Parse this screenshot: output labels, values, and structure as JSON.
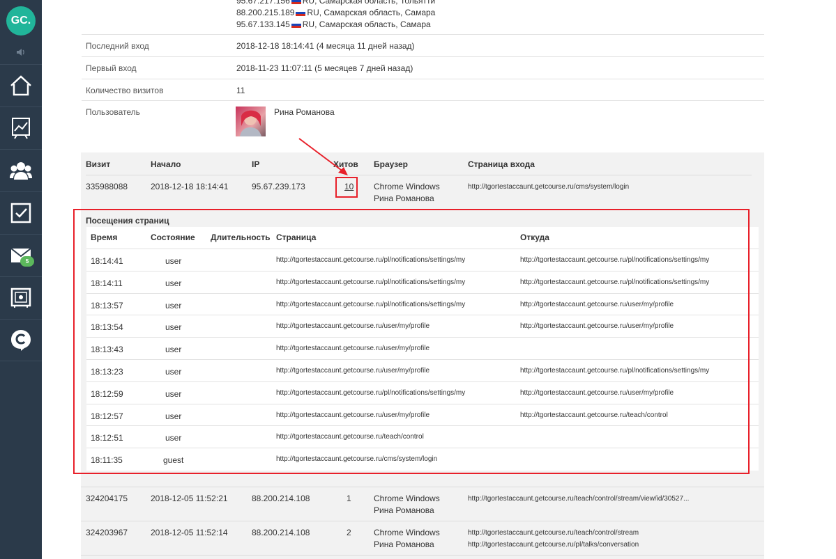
{
  "sidebar": {
    "logo": "GC.",
    "mail_badge": "5",
    "items": [
      "home-icon",
      "chart-icon",
      "users-icon",
      "tasks-icon",
      "mail-icon",
      "safe-icon",
      "chat-icon"
    ]
  },
  "ip_list": [
    {
      "ip": "95.67.217.156",
      "flag": "RU",
      "loc": "RU, Самарская область, Тольятти"
    },
    {
      "ip": "88.200.215.189",
      "flag": "RU",
      "loc": "RU, Самарская область, Самара"
    },
    {
      "ip": "95.67.133.145",
      "flag": "RU",
      "loc": "RU, Самарская область, Самара"
    }
  ],
  "info": {
    "last_login_label": "Последний вход",
    "last_login_value": "2018-12-18 18:14:41 (4 месяца 11 дней назад)",
    "first_login_label": "Первый вход",
    "first_login_value": "2018-11-23 11:07:11 (5 месяцев 7 дней назад)",
    "visits_count_label": "Количество визитов",
    "visits_count_value": "11",
    "user_label": "Пользователь",
    "user_name": "Рина Романова"
  },
  "visits_table": {
    "headers": {
      "visit": "Визит",
      "start": "Начало",
      "ip": "IP",
      "hits": "Хитов",
      "browser": "Браузер",
      "entry": "Страница входа"
    },
    "rows": [
      {
        "visit": "335988088",
        "start": "2018-12-18 18:14:41",
        "ip": "95.67.239.173",
        "hits": "10",
        "browser": "Chrome Windows",
        "user": "Рина Романова",
        "entry": "http://tgortestaccaunt.getcourse.ru/cms/system/login",
        "entry2": ""
      },
      {
        "visit": "324204175",
        "start": "2018-12-05 11:52:21",
        "ip": "88.200.214.108",
        "hits": "1",
        "browser": "Chrome Windows",
        "user": "Рина Романова",
        "entry": "http://tgortestaccaunt.getcourse.ru/teach/control/stream/view/id/30527...",
        "entry2": ""
      },
      {
        "visit": "324203967",
        "start": "2018-12-05 11:52:14",
        "ip": "88.200.214.108",
        "hits": "2",
        "browser": "Chrome Windows",
        "user": "Рина Романова",
        "entry": "http://tgortestaccaunt.getcourse.ru/teach/control/stream",
        "entry2": "http://tgortestaccaunt.getcourse.ru/pl/talks/conversation"
      }
    ]
  },
  "page_views": {
    "title": "Посещения страниц",
    "headers": {
      "time": "Время",
      "state": "Состояние",
      "duration": "Длительность",
      "page": "Страница",
      "from": "Откуда"
    },
    "rows": [
      {
        "time": "18:14:41",
        "state": "user",
        "page": "http://tgortestaccaunt.getcourse.ru/pl/notifications/settings/my",
        "from": "http://tgortestaccaunt.getcourse.ru/pl/notifications/settings/my"
      },
      {
        "time": "18:14:11",
        "state": "user",
        "page": "http://tgortestaccaunt.getcourse.ru/pl/notifications/settings/my",
        "from": "http://tgortestaccaunt.getcourse.ru/pl/notifications/settings/my"
      },
      {
        "time": "18:13:57",
        "state": "user",
        "page": "http://tgortestaccaunt.getcourse.ru/pl/notifications/settings/my",
        "from": "http://tgortestaccaunt.getcourse.ru/user/my/profile"
      },
      {
        "time": "18:13:54",
        "state": "user",
        "page": "http://tgortestaccaunt.getcourse.ru/user/my/profile",
        "from": "http://tgortestaccaunt.getcourse.ru/user/my/profile"
      },
      {
        "time": "18:13:43",
        "state": "user",
        "page": "http://tgortestaccaunt.getcourse.ru/user/my/profile",
        "from": ""
      },
      {
        "time": "18:13:23",
        "state": "user",
        "page": "http://tgortestaccaunt.getcourse.ru/user/my/profile",
        "from": "http://tgortestaccaunt.getcourse.ru/pl/notifications/settings/my"
      },
      {
        "time": "18:12:59",
        "state": "user",
        "page": "http://tgortestaccaunt.getcourse.ru/pl/notifications/settings/my",
        "from": "http://tgortestaccaunt.getcourse.ru/user/my/profile"
      },
      {
        "time": "18:12:57",
        "state": "user",
        "page": "http://tgortestaccaunt.getcourse.ru/user/my/profile",
        "from": "http://tgortestaccaunt.getcourse.ru/teach/control"
      },
      {
        "time": "18:12:51",
        "state": "user",
        "page": "http://tgortestaccaunt.getcourse.ru/teach/control",
        "from": ""
      },
      {
        "time": "18:11:35",
        "state": "guest",
        "page": "http://tgortestaccaunt.getcourse.ru/cms/system/login",
        "from": ""
      }
    ]
  },
  "colors": {
    "sidebar": "#2b3a4a",
    "accent": "#21b59a",
    "link": "#3a6ea5",
    "highlight": "#e8202a"
  }
}
